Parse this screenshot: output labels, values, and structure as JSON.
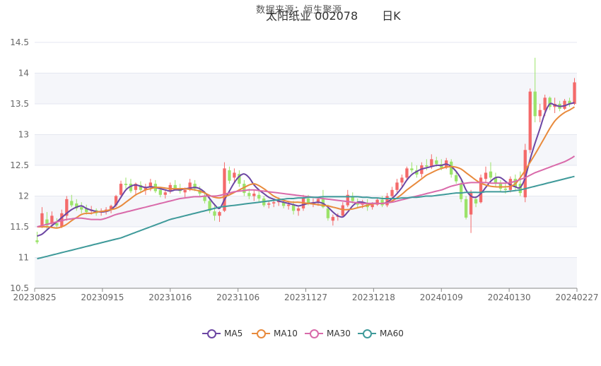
{
  "header": {
    "source_text": "数据来源：恒生聚源",
    "title": "太阳纸业 002078",
    "period": "日K"
  },
  "colors": {
    "up": "#f46a6a",
    "down": "#9be36a",
    "ma5": "#6c46a3",
    "ma10": "#e88a3c",
    "ma30": "#d96aaa",
    "ma60": "#3f9a9a",
    "plot_band": "#f5f6fa",
    "gridline": "#e4e7f0"
  },
  "chart_data": {
    "type": "candlestick",
    "title": "太阳纸业 002078 日K",
    "ylim": [
      10.5,
      14.5
    ],
    "y_ticks": [
      "10.5",
      "11",
      "11.5",
      "12",
      "12.5",
      "13",
      "13.5",
      "14",
      "14.5"
    ],
    "x_ticks": [
      "20230825",
      "20230915",
      "20231016",
      "20231106",
      "20231127",
      "20231218",
      "20240109",
      "20240130",
      "20240227"
    ],
    "legend": [
      "MA5",
      "MA10",
      "MA30",
      "MA60"
    ],
    "candles_ohlc": [
      [
        11.28,
        11.42,
        11.22,
        11.25
      ],
      [
        11.52,
        11.82,
        11.48,
        11.72
      ],
      [
        11.62,
        11.74,
        11.45,
        11.52
      ],
      [
        11.55,
        11.75,
        11.48,
        11.68
      ],
      [
        11.56,
        11.64,
        11.48,
        11.52
      ],
      [
        11.5,
        11.78,
        11.48,
        11.72
      ],
      [
        11.68,
        12.0,
        11.6,
        11.95
      ],
      [
        11.92,
        12.02,
        11.82,
        11.85
      ],
      [
        11.88,
        11.95,
        11.76,
        11.8
      ],
      [
        11.82,
        11.9,
        11.72,
        11.78
      ],
      [
        11.8,
        11.86,
        11.7,
        11.74
      ],
      [
        11.76,
        11.84,
        11.7,
        11.78
      ],
      [
        11.77,
        11.8,
        11.68,
        11.72
      ],
      [
        11.74,
        11.8,
        11.68,
        11.76
      ],
      [
        11.75,
        11.82,
        11.7,
        11.78
      ],
      [
        11.78,
        11.86,
        11.72,
        11.84
      ],
      [
        11.85,
        12.02,
        11.82,
        12.0
      ],
      [
        12.02,
        12.25,
        12.0,
        12.2
      ],
      [
        12.2,
        12.3,
        12.12,
        12.18
      ],
      [
        12.2,
        12.28,
        12.05,
        12.08
      ],
      [
        12.1,
        12.22,
        12.02,
        12.2
      ],
      [
        12.18,
        12.24,
        12.06,
        12.1
      ],
      [
        12.1,
        12.2,
        12.02,
        12.15
      ],
      [
        12.14,
        12.28,
        12.08,
        12.22
      ],
      [
        12.2,
        12.26,
        12.05,
        12.08
      ],
      [
        12.1,
        12.15,
        11.98,
        12.02
      ],
      [
        12.02,
        12.1,
        11.96,
        12.06
      ],
      [
        12.08,
        12.22,
        12.04,
        12.18
      ],
      [
        12.18,
        12.26,
        12.1,
        12.12
      ],
      [
        12.12,
        12.2,
        12.04,
        12.08
      ],
      [
        12.06,
        12.14,
        11.98,
        12.1
      ],
      [
        12.1,
        12.28,
        12.08,
        12.22
      ],
      [
        12.2,
        12.26,
        12.08,
        12.12
      ],
      [
        12.1,
        12.16,
        12.0,
        12.04
      ],
      [
        12.0,
        12.08,
        11.88,
        11.92
      ],
      [
        11.92,
        11.98,
        11.72,
        11.76
      ],
      [
        11.75,
        11.88,
        11.6,
        11.68
      ],
      [
        11.68,
        11.76,
        11.58,
        11.74
      ],
      [
        11.76,
        12.55,
        11.74,
        12.45
      ],
      [
        12.42,
        12.48,
        12.2,
        12.25
      ],
      [
        12.3,
        12.45,
        12.22,
        12.38
      ],
      [
        12.36,
        12.42,
        12.15,
        12.2
      ],
      [
        12.2,
        12.26,
        12.0,
        12.05
      ],
      [
        12.05,
        12.12,
        11.95,
        12.0
      ],
      [
        12.0,
        12.1,
        11.92,
        12.04
      ],
      [
        12.02,
        12.08,
        11.9,
        11.96
      ],
      [
        11.96,
        12.0,
        11.82,
        11.85
      ],
      [
        11.86,
        11.92,
        11.8,
        11.88
      ],
      [
        11.88,
        11.96,
        11.82,
        11.9
      ],
      [
        11.9,
        11.98,
        11.84,
        11.92
      ],
      [
        11.9,
        11.95,
        11.8,
        11.84
      ],
      [
        11.84,
        11.92,
        11.78,
        11.86
      ],
      [
        11.86,
        11.92,
        11.7,
        11.76
      ],
      [
        11.76,
        11.84,
        11.68,
        11.8
      ],
      [
        11.8,
        12.02,
        11.76,
        11.96
      ],
      [
        11.96,
        12.02,
        11.85,
        11.88
      ],
      [
        11.88,
        11.96,
        11.82,
        11.9
      ],
      [
        11.9,
        11.98,
        11.84,
        11.95
      ],
      [
        11.95,
        12.1,
        11.8,
        11.82
      ],
      [
        11.8,
        11.86,
        11.6,
        11.64
      ],
      [
        11.6,
        11.7,
        11.52,
        11.66
      ],
      [
        11.66,
        11.72,
        11.6,
        11.68
      ],
      [
        11.68,
        11.9,
        11.65,
        11.85
      ],
      [
        11.85,
        12.1,
        11.82,
        12.02
      ],
      [
        12.0,
        12.06,
        11.88,
        11.92
      ],
      [
        11.9,
        11.96,
        11.82,
        11.86
      ],
      [
        11.86,
        11.94,
        11.8,
        11.88
      ],
      [
        11.88,
        11.95,
        11.76,
        11.82
      ],
      [
        11.82,
        11.9,
        11.78,
        11.86
      ],
      [
        11.86,
        11.96,
        11.84,
        11.94
      ],
      [
        11.94,
        12.0,
        11.82,
        11.85
      ],
      [
        11.85,
        12.05,
        11.82,
        12.0
      ],
      [
        12.0,
        12.15,
        11.96,
        12.1
      ],
      [
        12.1,
        12.28,
        12.06,
        12.22
      ],
      [
        12.22,
        12.35,
        12.15,
        12.3
      ],
      [
        12.3,
        12.48,
        12.26,
        12.45
      ],
      [
        12.45,
        12.55,
        12.38,
        12.42
      ],
      [
        12.42,
        12.5,
        12.3,
        12.35
      ],
      [
        12.36,
        12.55,
        12.3,
        12.5
      ],
      [
        12.5,
        12.6,
        12.42,
        12.48
      ],
      [
        12.48,
        12.68,
        12.44,
        12.6
      ],
      [
        12.58,
        12.64,
        12.48,
        12.52
      ],
      [
        12.52,
        12.6,
        12.42,
        12.46
      ],
      [
        12.46,
        12.62,
        12.44,
        12.58
      ],
      [
        12.56,
        12.6,
        12.3,
        12.35
      ],
      [
        12.34,
        12.4,
        12.2,
        12.24
      ],
      [
        12.2,
        12.26,
        11.9,
        11.95
      ],
      [
        11.95,
        12.0,
        11.62,
        11.65
      ],
      [
        11.7,
        12.1,
        11.4,
        12.05
      ],
      [
        11.95,
        12.0,
        11.82,
        11.88
      ],
      [
        11.9,
        12.35,
        11.88,
        12.3
      ],
      [
        12.28,
        12.48,
        12.22,
        12.38
      ],
      [
        12.4,
        12.55,
        12.26,
        12.3
      ],
      [
        12.3,
        12.38,
        12.16,
        12.2
      ],
      [
        12.2,
        12.26,
        12.08,
        12.12
      ],
      [
        12.12,
        12.2,
        12.04,
        12.1
      ],
      [
        12.1,
        12.32,
        12.06,
        12.28
      ],
      [
        12.28,
        12.35,
        12.1,
        12.15
      ],
      [
        12.2,
        12.4,
        12.0,
        12.05
      ],
      [
        11.98,
        12.85,
        11.9,
        12.75
      ],
      [
        12.75,
        13.75,
        12.7,
        13.7
      ],
      [
        13.7,
        14.25,
        13.2,
        13.3
      ],
      [
        13.3,
        13.5,
        13.2,
        13.4
      ],
      [
        13.4,
        13.65,
        13.3,
        13.6
      ],
      [
        13.6,
        13.62,
        13.4,
        13.45
      ],
      [
        13.45,
        13.6,
        13.35,
        13.5
      ],
      [
        13.5,
        13.55,
        13.38,
        13.42
      ],
      [
        13.42,
        13.58,
        13.4,
        13.55
      ],
      [
        13.55,
        13.6,
        13.45,
        13.5
      ],
      [
        13.5,
        13.92,
        13.48,
        13.85
      ]
    ],
    "ma_values": {
      "MA5": [
        11.35,
        11.38,
        11.45,
        11.52,
        11.58,
        11.65,
        11.72,
        11.78,
        11.82,
        11.84,
        11.8,
        11.77,
        11.75,
        11.74,
        11.75,
        11.78,
        11.86,
        11.98,
        12.1,
        12.16,
        12.18,
        12.16,
        12.14,
        12.15,
        12.14,
        12.12,
        12.1,
        12.08,
        12.1,
        12.1,
        12.12,
        12.13,
        12.14,
        12.12,
        12.06,
        11.96,
        11.86,
        11.8,
        11.94,
        12.08,
        12.22,
        12.32,
        12.36,
        12.3,
        12.18,
        12.1,
        12.04,
        11.98,
        11.95,
        11.92,
        11.9,
        11.88,
        11.86,
        11.84,
        11.86,
        11.88,
        11.89,
        11.9,
        11.88,
        11.82,
        11.74,
        11.68,
        11.66,
        11.74,
        11.84,
        11.9,
        11.9,
        11.88,
        11.88,
        11.88,
        11.88,
        11.9,
        11.96,
        12.04,
        12.14,
        12.26,
        12.35,
        12.4,
        12.44,
        12.46,
        12.48,
        12.5,
        12.5,
        12.52,
        12.48,
        12.4,
        12.28,
        12.1,
        12.0,
        11.98,
        12.04,
        12.14,
        12.24,
        12.3,
        12.3,
        12.24,
        12.18,
        12.15,
        12.14,
        12.3,
        12.6,
        12.86,
        13.1,
        13.35,
        13.5,
        13.48,
        13.46,
        13.47,
        13.5,
        13.52
      ],
      "MA10": [
        11.5,
        11.5,
        11.5,
        11.49,
        11.48,
        11.5,
        11.54,
        11.6,
        11.65,
        11.7,
        11.72,
        11.72,
        11.74,
        11.75,
        11.76,
        11.78,
        11.8,
        11.84,
        11.9,
        11.96,
        12.02,
        12.06,
        12.1,
        12.12,
        12.14,
        12.14,
        12.13,
        12.12,
        12.12,
        12.12,
        12.12,
        12.11,
        12.1,
        12.08,
        12.05,
        12.01,
        11.98,
        11.97,
        11.99,
        12.02,
        12.06,
        12.1,
        12.14,
        12.18,
        12.2,
        12.17,
        12.12,
        12.06,
        12.0,
        11.96,
        11.93,
        11.91,
        11.9,
        11.9,
        11.89,
        11.88,
        11.87,
        11.86,
        11.85,
        11.84,
        11.82,
        11.8,
        11.78,
        11.78,
        11.79,
        11.81,
        11.83,
        11.85,
        11.87,
        11.88,
        11.88,
        11.89,
        11.92,
        11.97,
        12.03,
        12.1,
        12.16,
        12.22,
        12.28,
        12.34,
        12.38,
        12.42,
        12.45,
        12.47,
        12.48,
        12.47,
        12.44,
        12.38,
        12.32,
        12.26,
        12.21,
        12.18,
        12.16,
        12.15,
        12.15,
        12.15,
        12.16,
        12.2,
        12.3,
        12.42,
        12.55,
        12.68,
        12.82,
        12.96,
        13.1,
        13.22,
        13.3,
        13.36,
        13.4,
        13.45
      ],
      "MA30": [
        11.5,
        11.52,
        11.54,
        11.56,
        11.58,
        11.6,
        11.62,
        11.63,
        11.64,
        11.64,
        11.63,
        11.62,
        11.62,
        11.62,
        11.64,
        11.67,
        11.7,
        11.72,
        11.74,
        11.76,
        11.78,
        11.8,
        11.82,
        11.84,
        11.86,
        11.88,
        11.9,
        11.92,
        11.94,
        11.96,
        11.97,
        11.98,
        11.99,
        11.99,
        12.0,
        12.0,
        12.0,
        12.01,
        12.03,
        12.05,
        12.07,
        12.08,
        12.09,
        12.1,
        12.1,
        12.09,
        12.08,
        12.07,
        12.06,
        12.05,
        12.04,
        12.03,
        12.02,
        12.01,
        12.0,
        11.99,
        11.98,
        11.97,
        11.96,
        11.95,
        11.94,
        11.93,
        11.92,
        11.91,
        11.9,
        11.89,
        11.88,
        11.88,
        11.88,
        11.88,
        11.88,
        11.89,
        11.9,
        11.92,
        11.94,
        11.96,
        11.98,
        12.0,
        12.02,
        12.04,
        12.06,
        12.08,
        12.1,
        12.13,
        12.16,
        12.18,
        12.2,
        12.21,
        12.22,
        12.22,
        12.22,
        12.22,
        12.21,
        12.21,
        12.21,
        12.21,
        12.22,
        12.24,
        12.27,
        12.3,
        12.34,
        12.38,
        12.41,
        12.44,
        12.47,
        12.5,
        12.53,
        12.56,
        12.6,
        12.65
      ],
      "MA60": [
        10.98,
        11.0,
        11.02,
        11.04,
        11.06,
        11.08,
        11.1,
        11.12,
        11.14,
        11.16,
        11.18,
        11.2,
        11.22,
        11.24,
        11.26,
        11.28,
        11.3,
        11.32,
        11.35,
        11.38,
        11.41,
        11.44,
        11.47,
        11.5,
        11.53,
        11.56,
        11.59,
        11.62,
        11.64,
        11.66,
        11.68,
        11.7,
        11.72,
        11.74,
        11.76,
        11.78,
        11.8,
        11.82,
        11.83,
        11.84,
        11.85,
        11.86,
        11.87,
        11.88,
        11.89,
        11.9,
        11.91,
        11.92,
        11.93,
        11.94,
        11.95,
        11.96,
        11.96,
        11.97,
        11.97,
        11.98,
        11.98,
        11.98,
        11.99,
        11.99,
        11.99,
        11.99,
        11.99,
        11.99,
        11.99,
        11.99,
        11.98,
        11.98,
        11.97,
        11.97,
        11.96,
        11.96,
        11.96,
        11.96,
        11.97,
        11.97,
        11.98,
        11.98,
        11.99,
        12.0,
        12.0,
        12.01,
        12.02,
        12.03,
        12.04,
        12.05,
        12.05,
        12.06,
        12.06,
        12.06,
        12.06,
        12.07,
        12.07,
        12.07,
        12.07,
        12.07,
        12.08,
        12.09,
        12.1,
        12.12,
        12.14,
        12.16,
        12.18,
        12.2,
        12.22,
        12.24,
        12.26,
        12.28,
        12.3,
        12.32
      ]
    }
  }
}
